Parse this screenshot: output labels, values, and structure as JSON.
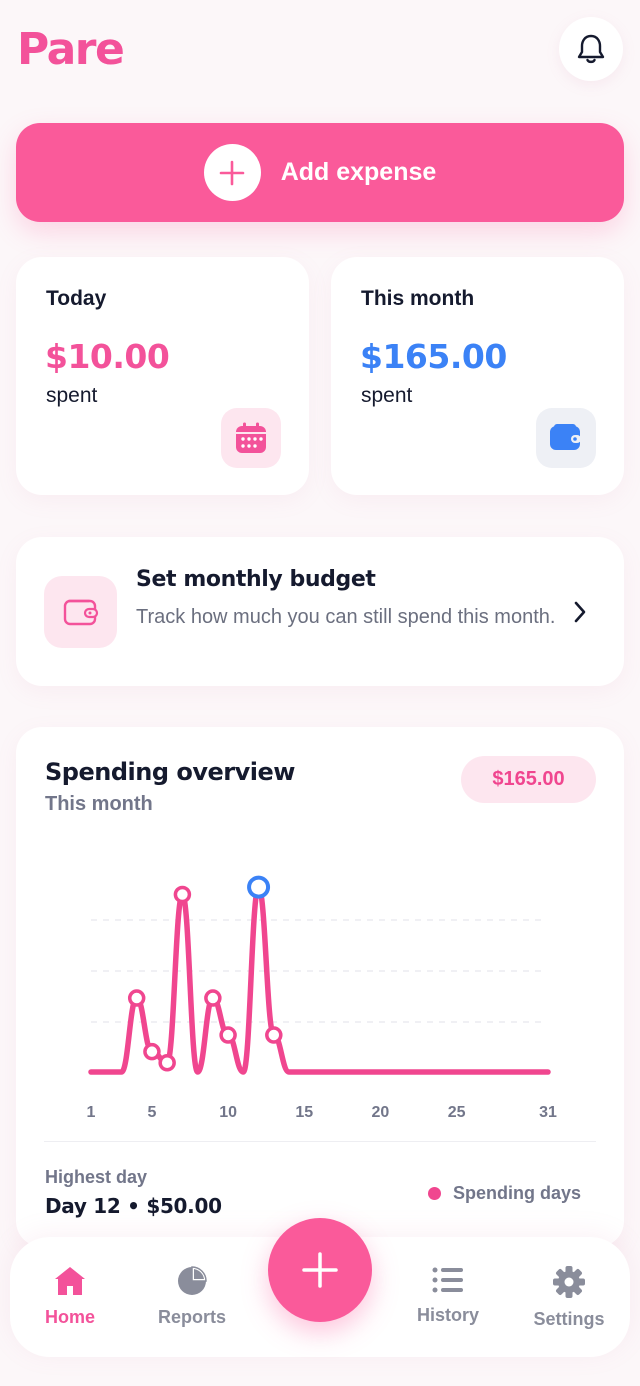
{
  "app": {
    "name": "Pare"
  },
  "primary_action": {
    "label": "Add expense"
  },
  "stats": {
    "today": {
      "label": "Today",
      "value": "$10.00",
      "sub": "spent"
    },
    "month": {
      "label": "This month",
      "value": "$165.00",
      "sub": "spent"
    }
  },
  "budget": {
    "title": "Set monthly budget",
    "description": "Track how much you can still spend this month."
  },
  "overview": {
    "title": "Spending overview",
    "period": "This month",
    "total": "$165.00",
    "highest_label": "Highest day",
    "highest_value": "Day 12 • $50.00",
    "legend": "Spending days"
  },
  "chart_data": {
    "type": "line",
    "x_ticks": [
      1,
      5,
      10,
      15,
      20,
      25,
      31
    ],
    "xlim": [
      1,
      31
    ],
    "ylim": [
      0,
      53
    ],
    "grid": true,
    "points": [
      {
        "x": 1,
        "y": 0
      },
      {
        "x": 2,
        "y": 0
      },
      {
        "x": 3,
        "y": 0
      },
      {
        "x": 4,
        "y": 20
      },
      {
        "x": 5,
        "y": 5.5
      },
      {
        "x": 6,
        "y": 2.5
      },
      {
        "x": 7,
        "y": 48
      },
      {
        "x": 8,
        "y": 0
      },
      {
        "x": 9,
        "y": 20
      },
      {
        "x": 10,
        "y": 10
      },
      {
        "x": 11,
        "y": 0
      },
      {
        "x": 12,
        "y": 50
      },
      {
        "x": 13,
        "y": 10
      },
      {
        "x": 14,
        "y": 0
      },
      {
        "x": 31,
        "y": 0
      }
    ],
    "spending_days": [
      4,
      5,
      6,
      7,
      9,
      10,
      12,
      13
    ],
    "highlight_day": 12,
    "line_color": "#f0468f",
    "highlight_color": "#3b82f6"
  },
  "nav": {
    "items": [
      {
        "label": "Home",
        "icon": "home-icon",
        "active": true
      },
      {
        "label": "Reports",
        "icon": "pie-chart-icon",
        "active": false
      },
      {
        "label": "History",
        "icon": "list-icon",
        "active": false
      },
      {
        "label": "Settings",
        "icon": "gear-icon",
        "active": false
      }
    ]
  },
  "colors": {
    "brand": "#f3529a",
    "accent_blue": "#3b82f6",
    "background": "#fcf7f9",
    "text": "#151a2e",
    "muted": "#72768a"
  }
}
